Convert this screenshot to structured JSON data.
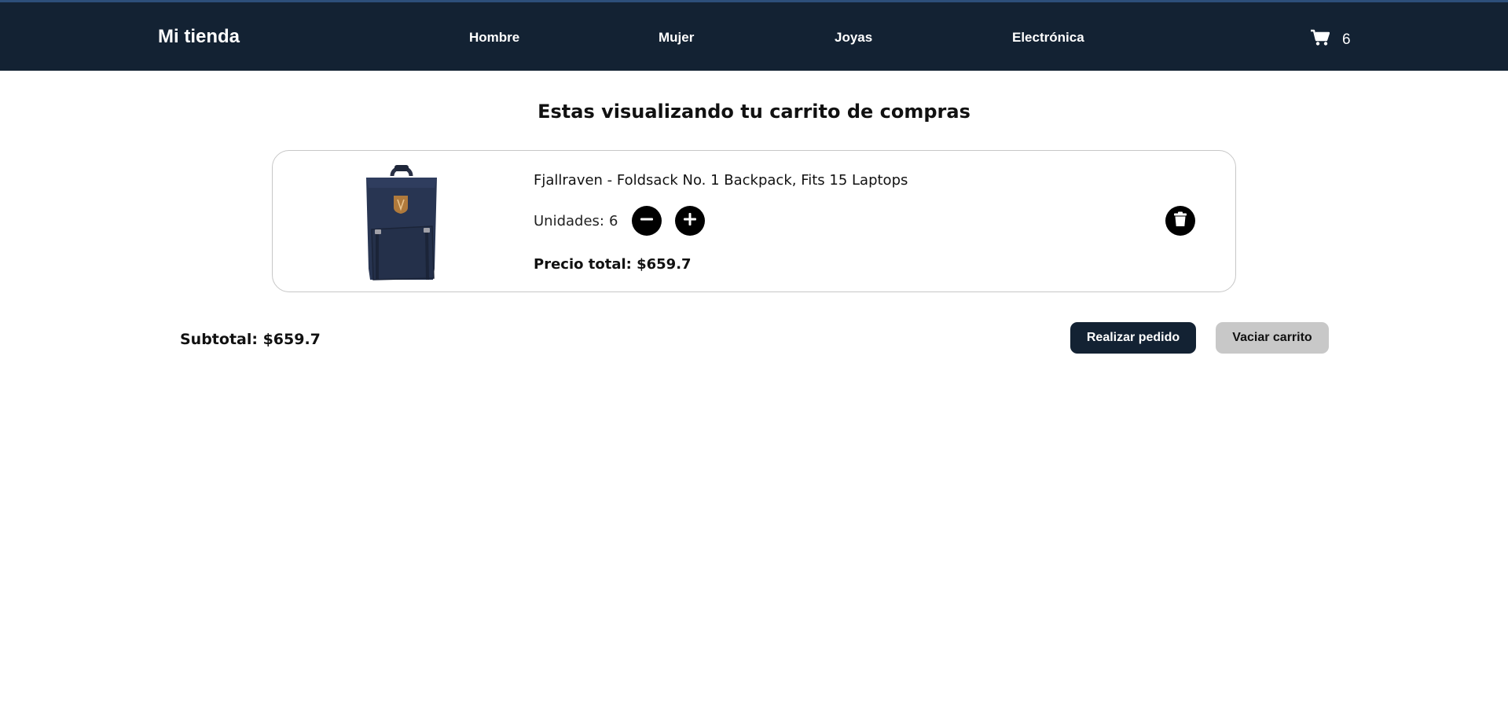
{
  "header": {
    "brand": "Mi tienda",
    "nav": [
      "Hombre",
      "Mujer",
      "Joyas",
      "Electrónica"
    ],
    "cart_icon": "cart-icon",
    "cart_count": "6",
    "background": "#132233"
  },
  "page_title": "Estas visualizando tu carrito de compras",
  "cart_item": {
    "image_icon": "backpack-product-image",
    "name": "Fjallraven - Foldsack No. 1 Backpack, Fits 15 Laptops",
    "units_label": "Unidades:",
    "units": "6",
    "decrease_icon": "minus-icon",
    "increase_icon": "plus-icon",
    "total": "Precio total: $659.7",
    "delete_icon": "trash-icon"
  },
  "summary": {
    "subtotal": "Subtotal: $659.7",
    "order_button": "Realizar pedido",
    "empty_button": "Vaciar carrito"
  },
  "colors": {
    "navy": "#132233",
    "secondary_button": "#c8c8c8",
    "card_border": "#c7c7c7"
  }
}
